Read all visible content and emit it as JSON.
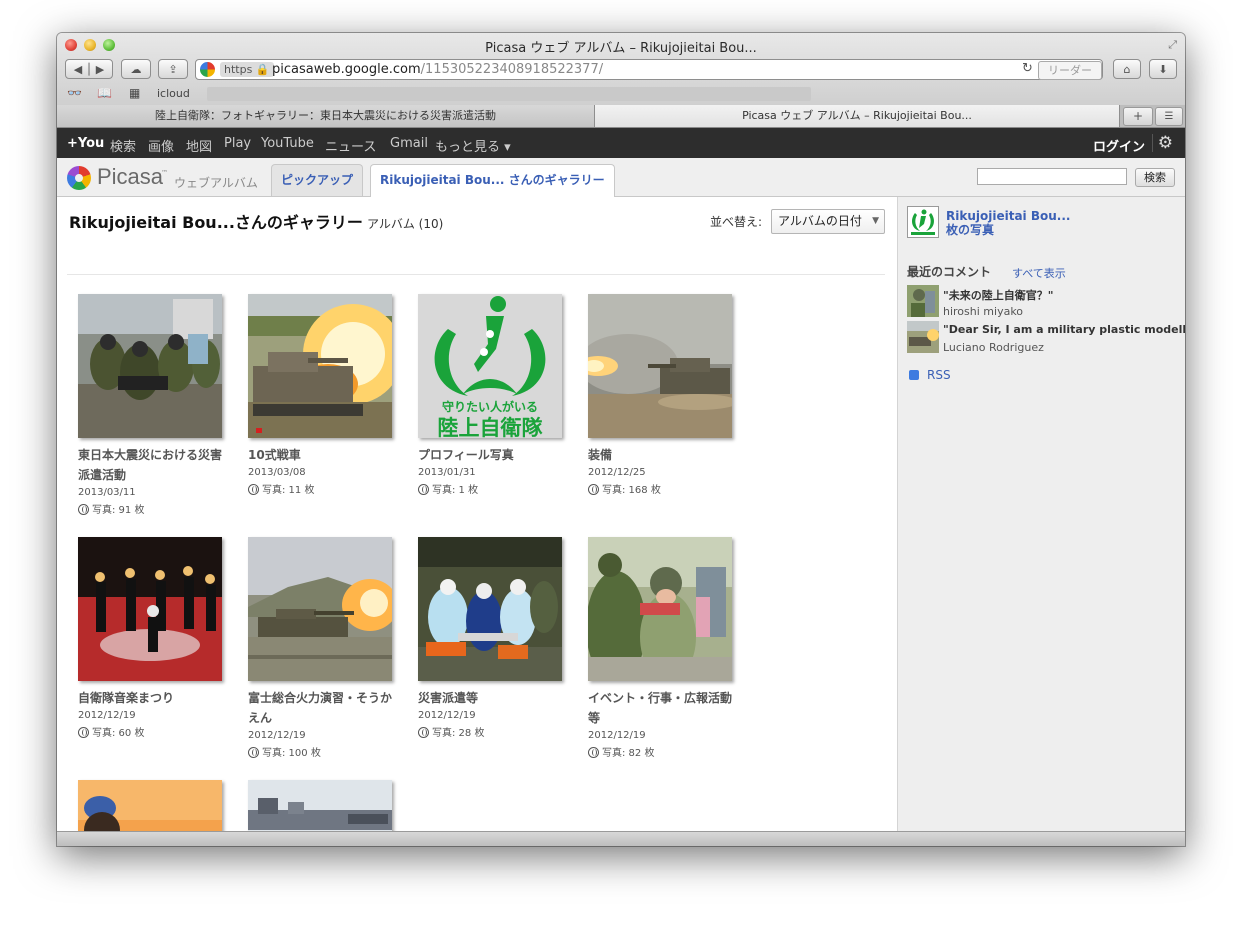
{
  "window": {
    "title": "Picasa ウェブ アルバム – Rikujojieitai Bou..."
  },
  "toolbar": {
    "url_scheme": "https",
    "url_host": "picasaweb.google.com",
    "url_path": "/115305223408918522377/",
    "reader_label": "リーダー"
  },
  "bookmarks": {
    "items": [
      "icloud"
    ]
  },
  "tabs": [
    {
      "label": "陸上自衛隊：フォトギャラリー：東日本大震災における災害派遣活動"
    },
    {
      "label": "Picasa ウェブ アルバム – Rikujojieitai Bou..."
    }
  ],
  "google_bar": {
    "items": [
      "+You",
      "検索",
      "画像",
      "地図",
      "Play",
      "YouTube",
      "ニュース",
      "Gmail",
      "もっと見る ▾"
    ],
    "login": "ログイン"
  },
  "picasa": {
    "logo": "Picasa",
    "tm": "™",
    "logo_sub": "ウェブアルバム",
    "tab_pickup": "ピックアップ",
    "tab_gallery": "Rikujojieitai Bou... さんのギャラリー",
    "search_button": "検索"
  },
  "gallery": {
    "title": "Rikujojieitai Bou...さんのギャラリー",
    "subtitle": "アルバム (10)",
    "sort_label": "並べ替え:",
    "sort_value": "アルバムの日付"
  },
  "albums": [
    {
      "title": "東日本大震災における災害派遣活動",
      "date": "2013/03/11",
      "count": "写真: 91 枚"
    },
    {
      "title": "10式戦車",
      "date": "2013/03/08",
      "count": "写真: 11 枚"
    },
    {
      "title": "プロフィール写真",
      "date": "2013/01/31",
      "count": "写真: 1 枚"
    },
    {
      "title": "装備",
      "date": "2012/12/25",
      "count": "写真: 168 枚"
    },
    {
      "title": "自衛隊音楽まつり",
      "date": "2012/12/19",
      "count": "写真: 60 枚"
    },
    {
      "title": "富士総合火力演習・そうかえん",
      "date": "2012/12/19",
      "count": "写真: 100 枚"
    },
    {
      "title": "災害派遣等",
      "date": "2012/12/19",
      "count": "写真: 28 枚"
    },
    {
      "title": "イベント・行事・広報活動等",
      "date": "2012/12/19",
      "count": "写真: 82 枚"
    }
  ],
  "profile_logo": {
    "line1": "守りたい人がいる",
    "line2": "陸上自衛隊"
  },
  "sidebar": {
    "profile_name": "Rikujojieitai Bou...",
    "profile_photos": "枚の写真",
    "recent_comments_title": "最近のコメント",
    "show_all": "すべて表示",
    "comments": [
      {
        "text": "\"未来の陸上自衛官？\"",
        "user": "hiroshi miyako"
      },
      {
        "text": "\"Dear Sir, I am a military plastic modell...",
        "user": "Luciano Rodriguez"
      }
    ],
    "rss": "RSS"
  }
}
